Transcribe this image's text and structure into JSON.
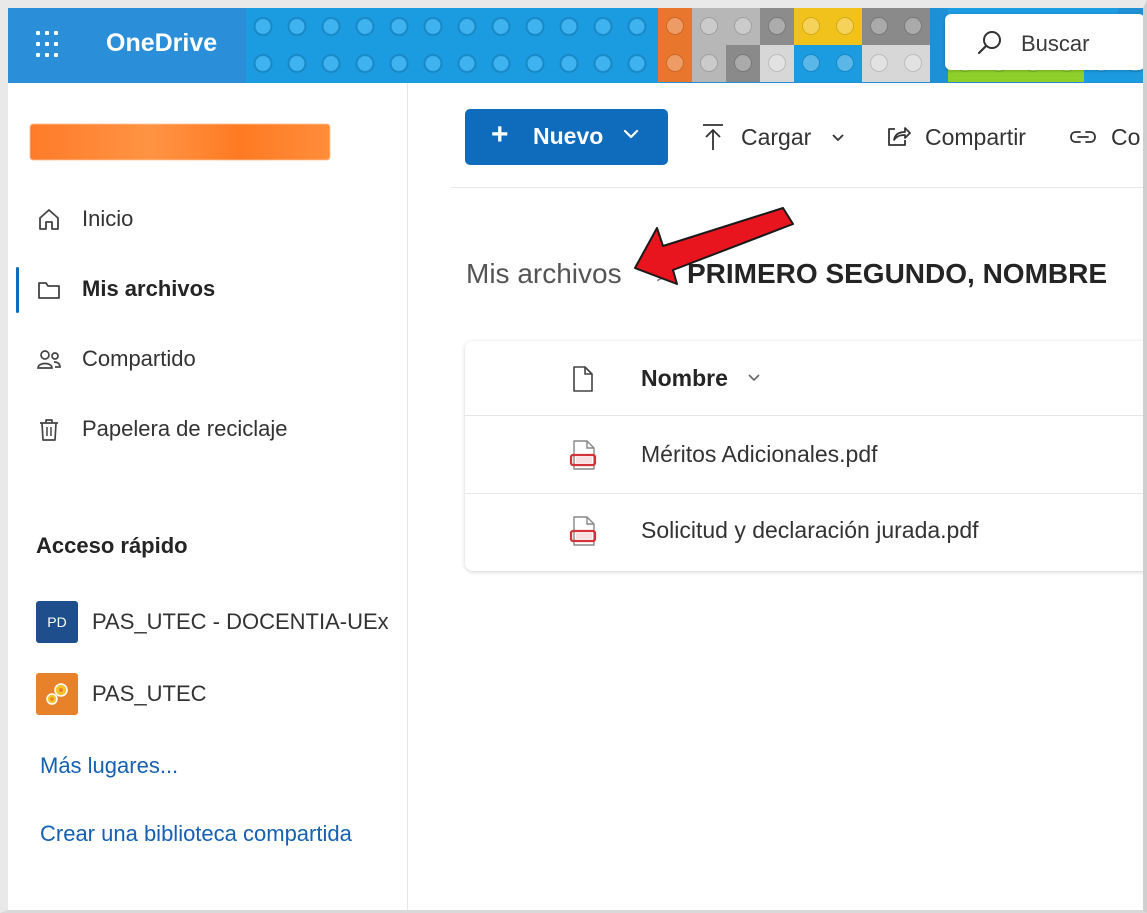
{
  "header": {
    "app_name": "OneDrive",
    "search_placeholder": "Buscar",
    "brand_color": "#0f6cbd"
  },
  "sidebar": {
    "nav": [
      {
        "label": "Inicio",
        "icon": "home-icon"
      },
      {
        "label": "Mis archivos",
        "icon": "folder-icon",
        "active": true
      },
      {
        "label": "Compartido",
        "icon": "people-icon"
      },
      {
        "label": "Papelera de reciclaje",
        "icon": "trash-icon"
      }
    ],
    "quick_access_title": "Acceso rápido",
    "quick_access": [
      {
        "label": "PAS_UTEC - DOCENTIA-UEx",
        "badge": "PD",
        "badge_color": "#1f4e8c"
      },
      {
        "label": "PAS_UTEC",
        "icon": "gears-icon",
        "badge_color": "#e8822a"
      }
    ],
    "more_places": "Más lugares...",
    "create_library": "Crear una biblioteca compartida"
  },
  "toolbar": {
    "new_label": "Nuevo",
    "upload_label": "Cargar",
    "share_label": "Compartir",
    "copy_link_label": "Co"
  },
  "breadcrumb": {
    "root": "Mis archivos",
    "separator": ">",
    "current": "PRIMERO SEGUNDO, NOMBRE"
  },
  "file_list": {
    "column_name": "Nombre",
    "files": [
      {
        "name": "Méritos Adicionales.pdf",
        "icon": "pdf-icon"
      },
      {
        "name": "Solicitud y declaración jurada.pdf",
        "icon": "pdf-icon"
      }
    ]
  },
  "annotation": {
    "arrow_color": "#e8141e"
  }
}
